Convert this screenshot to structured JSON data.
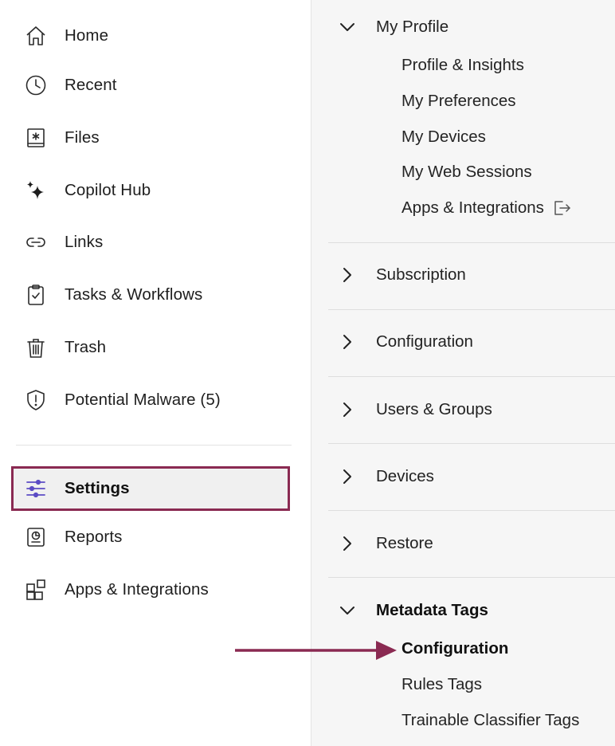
{
  "sidebar": {
    "items": [
      {
        "label": "Home",
        "icon": "home-icon"
      },
      {
        "label": "Recent",
        "icon": "clock-icon"
      },
      {
        "label": "Files",
        "icon": "files-icon"
      },
      {
        "label": "Copilot Hub",
        "icon": "sparkle-icon"
      },
      {
        "label": "Links",
        "icon": "link-icon"
      },
      {
        "label": "Tasks & Workflows",
        "icon": "clipboard-check-icon"
      },
      {
        "label": "Trash",
        "icon": "trash-icon"
      },
      {
        "label": "Potential Malware (5)",
        "icon": "shield-icon"
      }
    ],
    "lower_items": [
      {
        "label": "Settings",
        "icon": "sliders-icon",
        "active": true
      },
      {
        "label": "Reports",
        "icon": "report-icon"
      },
      {
        "label": "Apps & Integrations",
        "icon": "apps-grid-icon"
      }
    ]
  },
  "panel": {
    "sections": [
      {
        "title": "My Profile",
        "expanded": true,
        "items": [
          "Profile & Insights",
          "My Preferences",
          "My Devices",
          "My Web Sessions",
          "Apps & Integrations"
        ]
      },
      {
        "title": "Subscription",
        "expanded": false
      },
      {
        "title": "Configuration",
        "expanded": false
      },
      {
        "title": "Users & Groups",
        "expanded": false
      },
      {
        "title": "Devices",
        "expanded": false
      },
      {
        "title": "Restore",
        "expanded": false
      },
      {
        "title": "Metadata Tags",
        "expanded": true,
        "items": [
          "Configuration",
          "Rules Tags",
          "Trainable Classifier Tags"
        ]
      }
    ]
  },
  "colors": {
    "highlight_border": "#8a2a52",
    "active_icon": "#5b4bc4",
    "arrow": "#8a2a52",
    "panel_bg": "#f6f6f6"
  }
}
